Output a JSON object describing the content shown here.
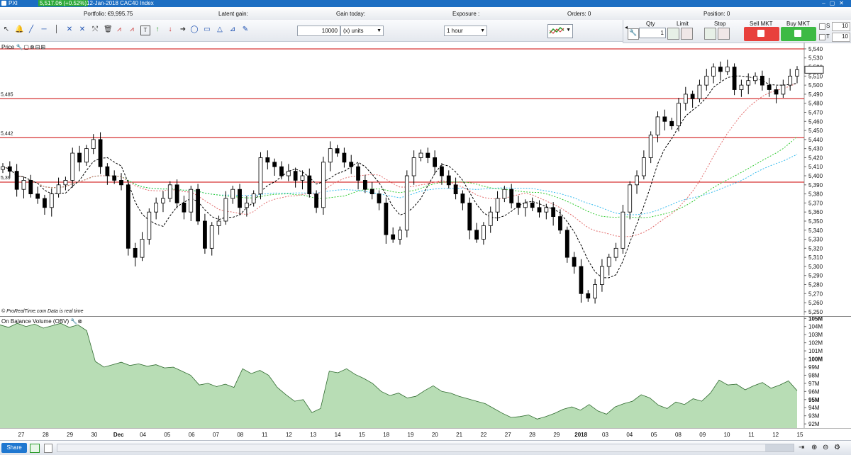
{
  "window": {
    "instrument": "PXI",
    "price_change": "5,517.06 (+0.52%)",
    "name": "12-Jan-2018 CAC40 Index"
  },
  "infobar": {
    "portfolio": "Portfolio: €9,995.75",
    "latent_gain": "Latent gain:",
    "gain_today": "Gain today:",
    "exposure": "Exposure :",
    "orders": "Orders: 0",
    "position": "Position: 0"
  },
  "toolbar": {
    "quantity_value": "10000",
    "units_label": "(x) units",
    "timeframe": "1 hour"
  },
  "order_panel": {
    "qty_label": "Qty",
    "qty_value": "1",
    "limit_label": "Limit",
    "stop_label": "Stop",
    "sell_label": "Sell MKT",
    "buy_label": "Buy MKT",
    "s_label": "S",
    "s_value": "10",
    "t_label": "T",
    "t_value": "10"
  },
  "price_panel": {
    "title": "Price",
    "credit": "© ProRealTime.com  Data is real time",
    "hlines": [
      {
        "label": "",
        "value": 5540
      },
      {
        "label": "5,485",
        "value": 5485
      },
      {
        "label": "5,442",
        "value": 5442
      },
      {
        "label": "5,39",
        "value": 5393
      }
    ],
    "last_price": "5,517.06"
  },
  "obv_panel": {
    "title": "On Balance Volume (OBV)",
    "current": "96M"
  },
  "statusbar": {
    "share_label": "Share"
  },
  "colors": {
    "up": "#ffffff",
    "down": "#000000",
    "obv_fill": "#b8ddb5",
    "hline": "#cc0000",
    "ma_fast": "#000000",
    "ma_slow": "#e26b6b",
    "ma_green": "#33cc33",
    "ma_cyan": "#33bbee"
  },
  "chart_data": [
    {
      "type": "line",
      "title": "Price",
      "x_ticks": [
        "27",
        "28",
        "29",
        "30",
        "Dec",
        "04",
        "05",
        "06",
        "07",
        "08",
        "11",
        "12",
        "13",
        "14",
        "15",
        "18",
        "19",
        "20",
        "21",
        "22",
        "27",
        "28",
        "29",
        "2018",
        "03",
        "04",
        "05",
        "08",
        "09",
        "10",
        "11",
        "12",
        "15"
      ],
      "y_ticks": [
        "5,540",
        "5,530",
        "5,520",
        "5,510",
        "5,500",
        "5,490",
        "5,480",
        "5,470",
        "5,460",
        "5,450",
        "5,440",
        "5,430",
        "5,420",
        "5,410",
        "5,400",
        "5,390",
        "5,380",
        "5,370",
        "5,360",
        "5,350",
        "5,340",
        "5,330",
        "5,320",
        "5,310",
        "5,300",
        "5,290",
        "5,280",
        "5,270",
        "5,260",
        "5,250"
      ],
      "ylim": [
        5246,
        5547
      ],
      "series": [
        {
          "values": [
            5410,
            5405,
            5385,
            5395,
            5380,
            5375,
            5365,
            5380,
            5390,
            5395,
            5425,
            5415,
            5430,
            5440,
            5410,
            5400,
            5395,
            5390,
            5320,
            5310,
            5330,
            5360,
            5370,
            5375,
            5390,
            5370,
            5360,
            5385,
            5350,
            5320,
            5345,
            5350,
            5375,
            5385,
            5365,
            5370,
            5380,
            5420,
            5415,
            5410,
            5400,
            5405,
            5395,
            5400,
            5380,
            5365,
            5415,
            5430,
            5425,
            5415,
            5410,
            5395,
            5385,
            5380,
            5370,
            5335,
            5330,
            5340,
            5400,
            5420,
            5425,
            5420,
            5410,
            5400,
            5390,
            5380,
            5370,
            5340,
            5330,
            5345,
            5360,
            5375,
            5385,
            5370,
            5365,
            5370,
            5365,
            5360,
            5365,
            5355,
            5340,
            5310,
            5300,
            5270,
            5265,
            5280,
            5300,
            5310,
            5320,
            5360,
            5390,
            5400,
            5420,
            5445,
            5465,
            5460,
            5455,
            5480,
            5490,
            5485,
            5500,
            5510,
            5520,
            5515,
            5520,
            5495,
            5500,
            5505,
            5510,
            5500,
            5495,
            5490,
            5500,
            5510,
            5517
          ]
        }
      ]
    },
    {
      "type": "area",
      "title": "On Balance Volume (OBV)",
      "y_ticks": [
        "105M",
        "104M",
        "103M",
        "102M",
        "101M",
        "100M",
        "99M",
        "98M",
        "97M",
        "96M",
        "95M",
        "94M",
        "93M",
        "92M"
      ],
      "ylim": [
        91.4,
        105.2
      ],
      "series": [
        {
          "values": [
            104.2,
            103.9,
            104.4,
            104.0,
            104.3,
            103.8,
            104.1,
            104.4,
            103.9,
            104.2,
            103.5,
            99.7,
            99.0,
            99.3,
            99.6,
            99.2,
            99.4,
            99.1,
            99.3,
            98.9,
            99.0,
            98.5,
            98.0,
            96.8,
            97.0,
            96.6,
            96.9,
            96.5,
            98.8,
            98.2,
            98.6,
            98.0,
            96.5,
            95.6,
            94.8,
            95.0,
            93.4,
            93.9,
            98.5,
            98.3,
            98.8,
            98.1,
            97.6,
            97.0,
            96.0,
            95.5,
            95.8,
            95.2,
            95.4,
            96.1,
            96.7,
            96.0,
            95.8,
            95.4,
            95.1,
            94.8,
            94.5,
            93.9,
            93.3,
            92.8,
            92.9,
            93.1,
            92.6,
            92.9,
            93.3,
            93.8,
            94.1,
            93.7,
            94.4,
            93.6,
            93.2,
            94.1,
            94.5,
            94.8,
            95.6,
            95.2,
            94.3,
            93.9,
            94.7,
            94.4,
            95.1,
            94.8,
            95.8,
            97.4,
            96.8,
            96.9,
            96.2,
            96.7,
            97.1,
            96.4,
            96.8,
            97.3,
            96.1
          ]
        }
      ]
    }
  ]
}
